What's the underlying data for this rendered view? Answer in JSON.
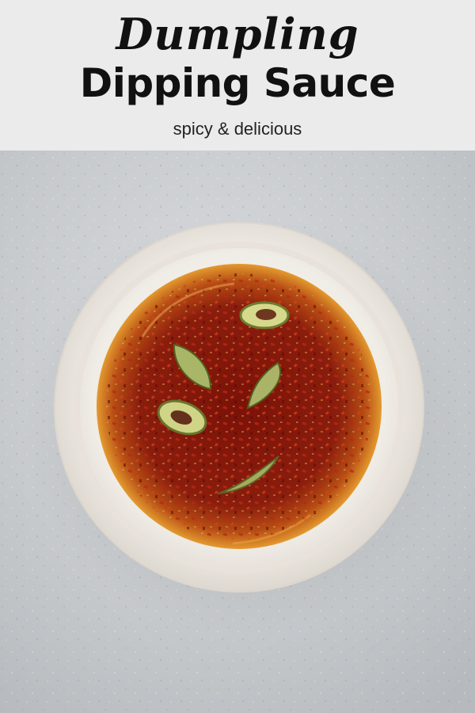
{
  "header": {
    "script_title": "Dumpling",
    "main_title": "Dipping Sauce",
    "subtitle": "spicy & delicious"
  },
  "photo": {
    "subject": "bowl-of-chili-oil",
    "colors": {
      "background": "#c7cacd",
      "bowl": "#efebe4",
      "oil": "#d8891d",
      "chili": "#7c140b",
      "scallion": "#9fae53"
    }
  }
}
